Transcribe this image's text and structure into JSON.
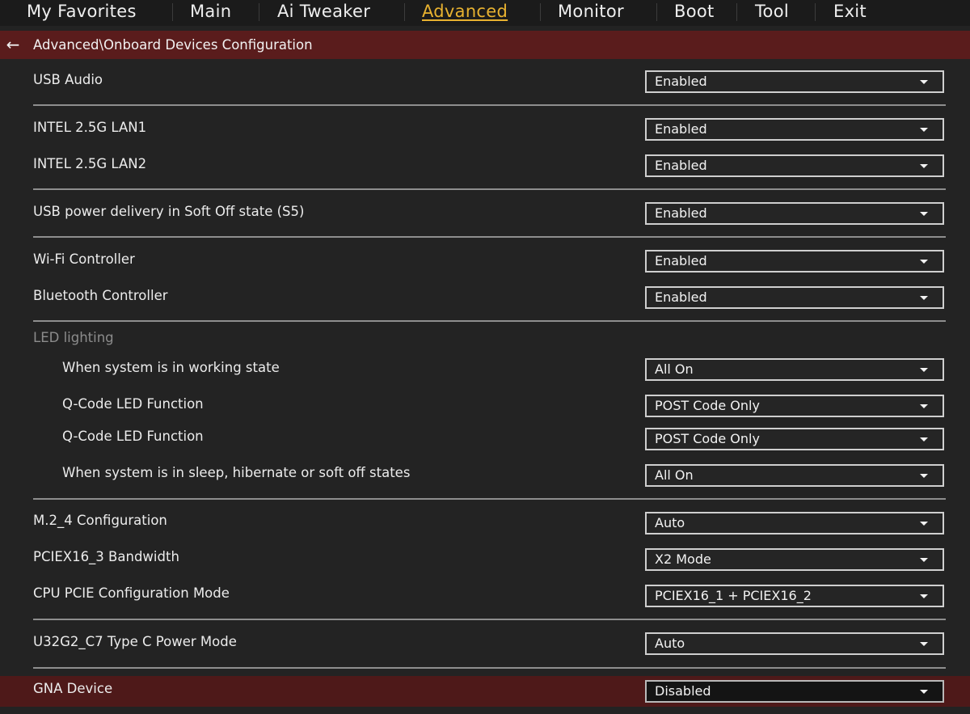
{
  "menu": {
    "tabs": [
      {
        "label": "My Favorites"
      },
      {
        "label": "Main"
      },
      {
        "label": "Ai Tweaker"
      },
      {
        "label": "Advanced"
      },
      {
        "label": "Monitor"
      },
      {
        "label": "Boot"
      },
      {
        "label": "Tool"
      },
      {
        "label": "Exit"
      }
    ],
    "active_tab": "Advanced"
  },
  "breadcrumb": {
    "back_icon": "arrow-left-icon",
    "path": "Advanced\\Onboard Devices Configuration"
  },
  "settings": {
    "usb_audio": {
      "label": "USB Audio",
      "value": "Enabled"
    },
    "lan1": {
      "label": "INTEL 2.5G LAN1",
      "value": "Enabled"
    },
    "lan2": {
      "label": "INTEL 2.5G LAN2",
      "value": "Enabled"
    },
    "usb_power_s5": {
      "label": "USB power delivery in Soft Off state (S5)",
      "value": "Enabled"
    },
    "wifi": {
      "label": "Wi-Fi Controller",
      "value": "Enabled"
    },
    "bluetooth": {
      "label": "Bluetooth Controller",
      "value": "Enabled"
    },
    "led_group_label": "LED lighting",
    "led_working": {
      "label": "When system is in working state",
      "value": "All On"
    },
    "qcode_1": {
      "label": "Q-Code LED Function",
      "value": "POST Code Only"
    },
    "qcode_2": {
      "label": "Q-Code LED Function",
      "value": "POST Code Only"
    },
    "led_sleep": {
      "label": "When system is in sleep, hibernate or soft off states",
      "value": "All On"
    },
    "m2_4": {
      "label": "M.2_4 Configuration",
      "value": "Auto"
    },
    "pciex16_3": {
      "label": "PCIEX16_3 Bandwidth",
      "value": "X2 Mode"
    },
    "cpu_pcie": {
      "label": "CPU PCIE Configuration Mode",
      "value": "PCIEX16_1 + PCIEX16_2"
    },
    "u32g2_c7": {
      "label": "U32G2_C7 Type C Power Mode",
      "value": "Auto"
    },
    "gna": {
      "label": "GNA Device",
      "value": "Disabled"
    }
  },
  "colors": {
    "background": "#232323",
    "accent_active_tab": "#e8b230",
    "header_bar": "#5a1c1c",
    "selected_row": "#4e1919"
  }
}
